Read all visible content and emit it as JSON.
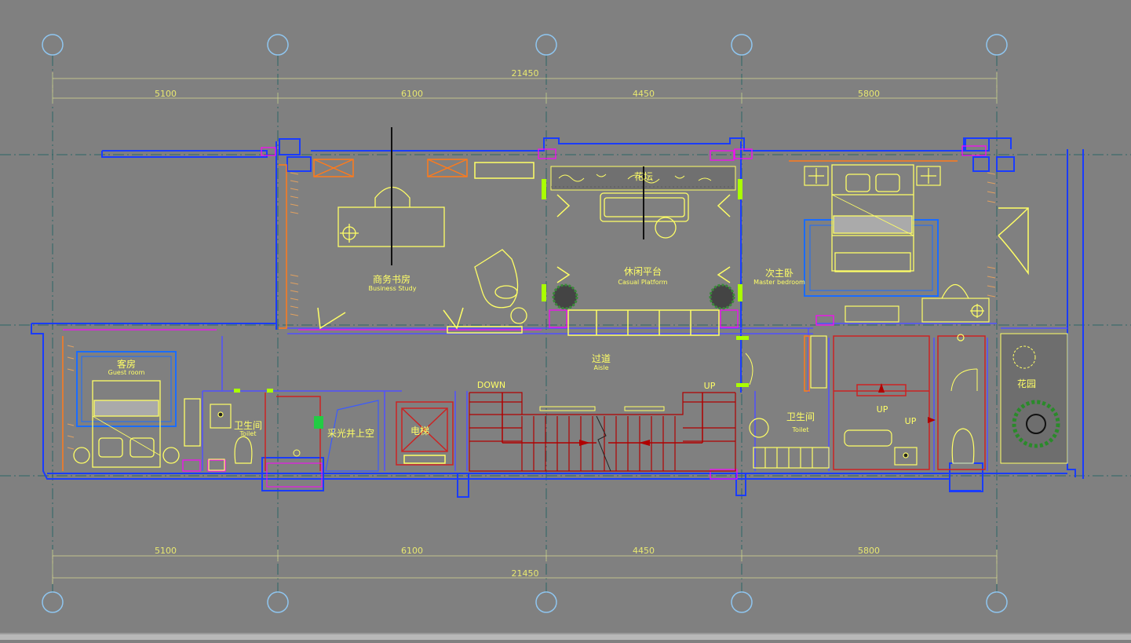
{
  "colors": {
    "background": "#808080",
    "axis_circle": "#8fc6f0",
    "axis_line": "#2c6666",
    "dimension": "#e8e870",
    "wall_outer": "#1a3cff",
    "wall_inner": "#ff00ff",
    "furniture": "#ffff66",
    "stair": "#b00000",
    "wood": "#ff7a1a"
  },
  "dimensions": {
    "total_top": "21450",
    "segments_top": [
      "5100",
      "6100",
      "4450",
      "5800"
    ],
    "total_bottom": "21450",
    "segments_bottom": [
      "5100",
      "6100",
      "4450",
      "5800"
    ]
  },
  "rooms": {
    "study": {
      "cn": "商务书房",
      "en": "Business Study"
    },
    "platform": {
      "cn": "休闲平台",
      "en": "Casual Platform"
    },
    "master": {
      "cn": "次主卧",
      "en": "Master bedroom"
    },
    "aisle": {
      "cn": "过道",
      "en": "Aisle"
    },
    "guest": {
      "cn": "客房",
      "en": "Guest room"
    },
    "toilet1": {
      "cn": "卫生间",
      "en": "Toilet"
    },
    "toilet2": {
      "cn": "卫生间",
      "en": "Toilet"
    },
    "skylight": {
      "cn": "采光井上空"
    },
    "elevator": {
      "cn": "电梯"
    },
    "garden": {
      "cn": "花园"
    },
    "planter": {
      "cn": "花坛"
    }
  },
  "labels": {
    "stair_down": "DOWN",
    "stair_up": "UP",
    "up_a": "UP",
    "up_b": "UP"
  }
}
